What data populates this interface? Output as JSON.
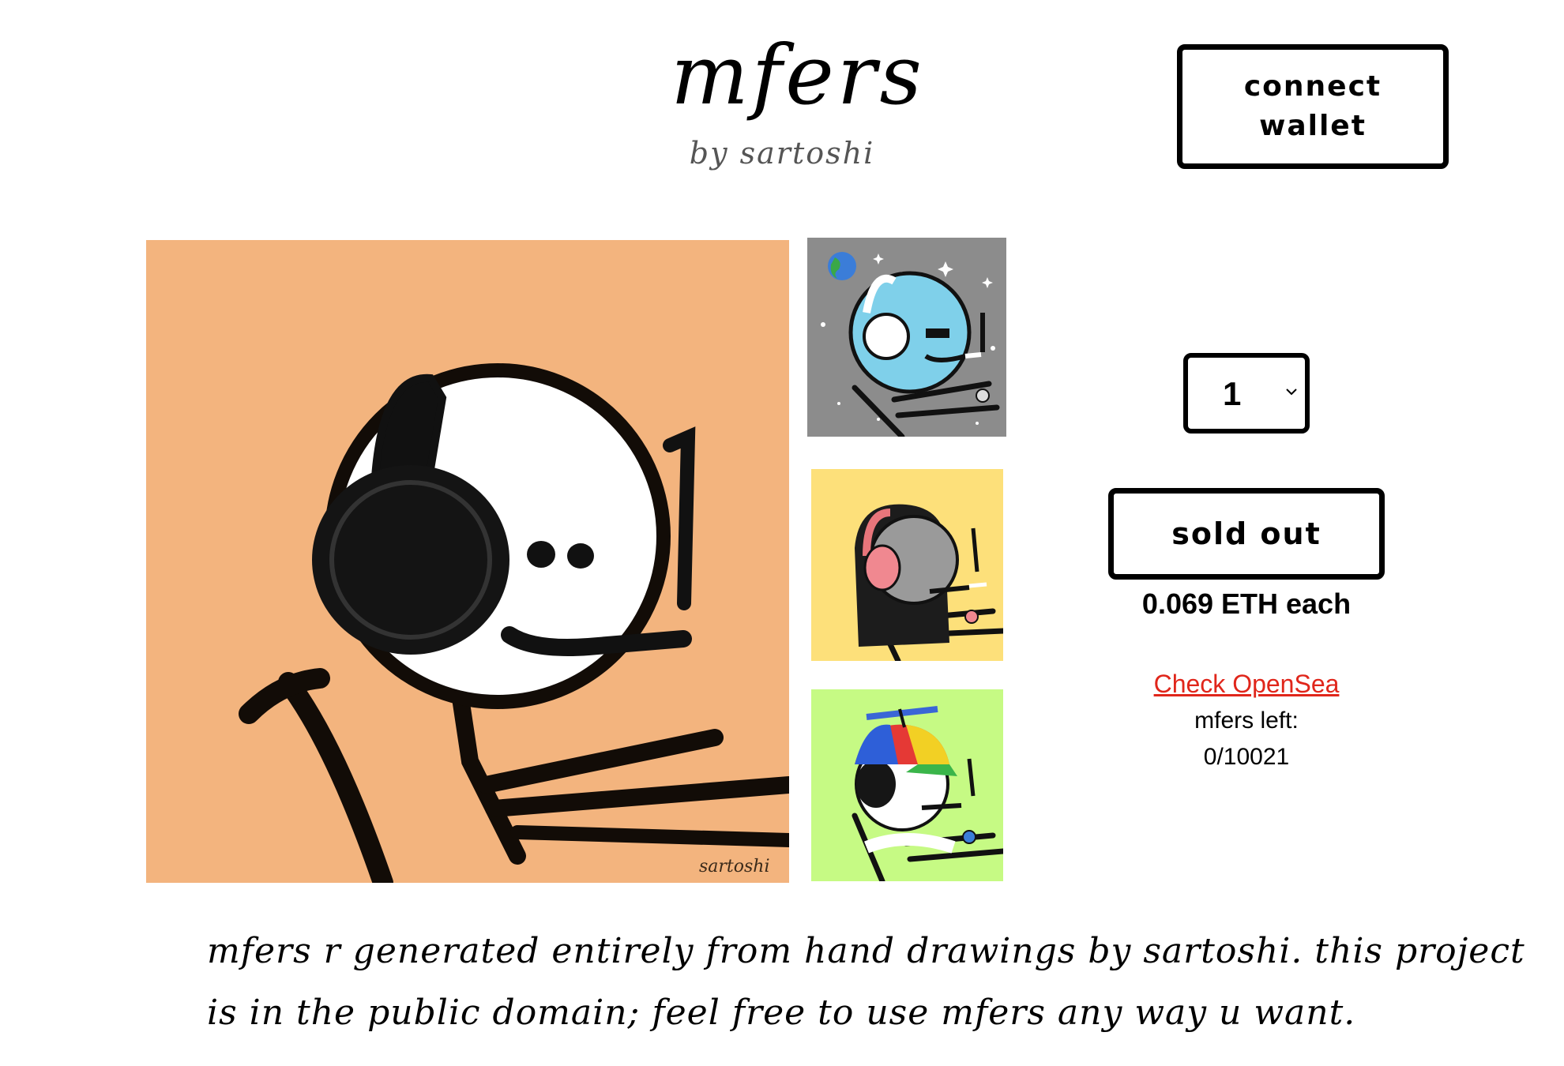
{
  "header": {
    "title": "mfers",
    "subtitle": "by sartoshi",
    "connect_button": {
      "line1": "connect",
      "line2": "wallet"
    }
  },
  "gallery": {
    "main_signature": "sartoshi",
    "colors": {
      "main_bg": "#f3b47e",
      "thumb1_bg": "#8c8c8c",
      "thumb2_bg": "#fde07a",
      "thumb3_bg": "#c6fa84"
    }
  },
  "mint": {
    "quantity": "1",
    "sold_out_label": "sold out",
    "price_text": "0.069 ETH each",
    "opensea_link": "Check OpenSea",
    "remaining_label": "mfers left:",
    "remaining_count": "0/10021",
    "link_color": "#e0261b"
  },
  "description": {
    "line1": "mfers r generated entirely from hand drawings by sartoshi. this project",
    "line2": "is in the public domain; feel free to use mfers any way u want."
  }
}
